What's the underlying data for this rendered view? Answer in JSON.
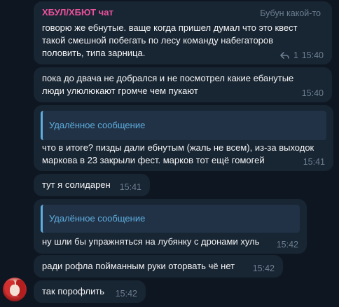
{
  "messages": [
    {
      "author": "ХБУЛ/ХБЮТ чат",
      "author_right": "Бубун какой-то",
      "lines": [
        "говорю же ебнутые. ваще когда пришел думал что это квест",
        "такой смешной побегать по лесу команду набегаторов",
        "половить, типа зарница."
      ],
      "reply_icon": "reply-arrow-icon",
      "reply_count": "1",
      "time": "15:40"
    },
    {
      "lines": [
        "пока до двача не добрался и не посмотрел какие ебанутые",
        "люди улюлюкают громче чем пукают"
      ],
      "time": "15:40"
    },
    {
      "quote": "Удалённое сообщение",
      "lines": [
        "что в итоге? пизды дали ебнутым (жаль не всем), из-за выходок",
        "маркова в 23 закрыли фест. марков тот ещё гомогей"
      ],
      "time": "15:41"
    },
    {
      "lines": [
        "тут я солидарен"
      ],
      "time": "15:41"
    },
    {
      "quote": "Удалённое сообщение",
      "lines": [
        "ну шли бы упражняться на лубянку с дронами хуль"
      ],
      "time": "15:42"
    },
    {
      "lines": [
        "ради рофла пойманным руки оторвать чё нет"
      ],
      "time": "15:42"
    },
    {
      "lines": [
        "так порофлить"
      ],
      "time": "15:42"
    }
  ],
  "colors": {
    "background": "#0e1621",
    "bubble": "#182533",
    "author": "#e8529a",
    "quote_accent": "#5eaee0",
    "time": "#6d7f8f"
  }
}
